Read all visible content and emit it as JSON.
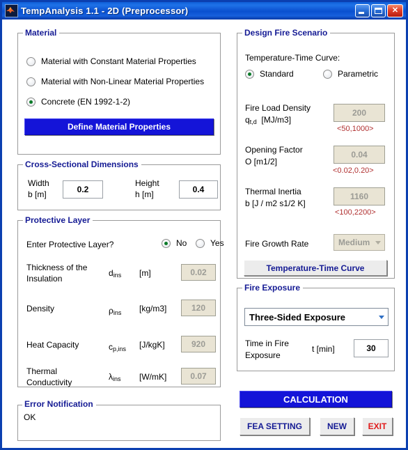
{
  "window": {
    "title": "TempAnalysis 1.1  -  2D (Preprocessor)",
    "icon": "matlab-icon",
    "minimize_label": "Minimize",
    "maximize_label": "Maximize",
    "close_label": "✕",
    "accent_titlebar": "#0a50cf",
    "accent_legend": "#151b94",
    "accent_range_text": "#b03030"
  },
  "material": {
    "legend": "Material",
    "options": [
      {
        "label": "Material with Constant Material Properties",
        "selected": false
      },
      {
        "label": "Material with Non-Linear Material Properties",
        "selected": false
      },
      {
        "label": "Concrete (EN 1992-1-2)",
        "selected": true
      }
    ],
    "define_button": "Define Material Properties"
  },
  "cross_section": {
    "legend": "Cross-Sectional Dimensions",
    "width": {
      "label_line1": "Width",
      "label_line2": "b [m]",
      "value": "0.2",
      "enabled": true
    },
    "height": {
      "label_line1": "Height",
      "label_line2": "h [m]",
      "value": "0.4",
      "enabled": true
    }
  },
  "protective_layer": {
    "legend": "Protective Layer",
    "question": "Enter Protective Layer?",
    "option_no": "No",
    "option_yes": "Yes",
    "selected": "No",
    "rows": [
      {
        "label_line1": "Thickness of the",
        "label_line2": "Insulation",
        "symbol": "d",
        "symbol_sub": "ins",
        "unit": "[m]",
        "value": "0.02",
        "enabled": false
      },
      {
        "label_line1": "Density",
        "label_line2": "",
        "symbol": "ρ",
        "symbol_sub": "ins",
        "unit": "[kg/m3]",
        "value": "120",
        "enabled": false
      },
      {
        "label_line1": "Heat Capacity",
        "label_line2": "",
        "symbol": "c",
        "symbol_sub": "p,ins",
        "unit": "[J/kgK]",
        "value": "920",
        "enabled": false
      },
      {
        "label_line1": "Thermal",
        "label_line2": "Conductivity",
        "symbol": "λ",
        "symbol_sub": "ins",
        "unit": "[W/mK]",
        "value": "0.07",
        "enabled": false
      }
    ]
  },
  "error_notification": {
    "legend": "Error Notification",
    "message": "OK"
  },
  "design_fire": {
    "legend": "Design Fire Scenario",
    "curve_label": "Temperature-Time Curve:",
    "option_standard": "Standard",
    "option_parametric": "Parametric",
    "selected_curve": "Standard",
    "fire_load": {
      "label_line1": "Fire Load Density",
      "symbol": "q",
      "symbol_sub": "t,d",
      "unit": "[MJ/m3]",
      "value": "200",
      "range": "<50,1000>",
      "enabled": false
    },
    "opening_factor": {
      "label_line1": "Opening Factor",
      "label_line2": "O [m1/2]",
      "value": "0.04",
      "range": "<0.02,0.20>",
      "enabled": false
    },
    "thermal_inertia": {
      "label_line1": "Thermal Inertia",
      "label_line2": "b [J / m2 s1/2 K]",
      "value": "1160",
      "range": "<100,2200>",
      "enabled": false
    },
    "growth_rate": {
      "label": "Fire Growth Rate",
      "value": "Medium",
      "enabled": false
    },
    "curve_button": "Temperature-Time Curve"
  },
  "fire_exposure": {
    "legend": "Fire Exposure",
    "exposure_select_value": "Three-Sided Exposure",
    "time_label_line1": "Time in Fire",
    "time_label_line2": "Exposure",
    "time_symbol": "t [min]",
    "time_value": "30",
    "time_enabled": true
  },
  "actions": {
    "calculation": "CALCULATION",
    "fea_setting": "FEA SETTING",
    "new": "NEW",
    "exit": "EXIT"
  }
}
